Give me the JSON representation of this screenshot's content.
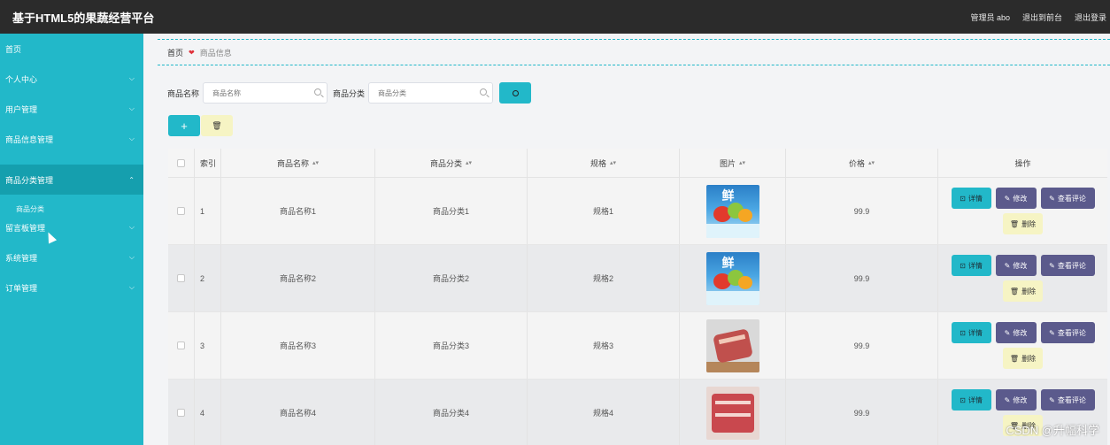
{
  "header": {
    "title": "基于HTML5的果蔬经营平台",
    "user_label": "管理员 abo",
    "back_to_front": "退出到前台",
    "logout": "退出登录"
  },
  "sidebar": {
    "items": [
      {
        "label": "首页",
        "has_chevron": false
      },
      {
        "label": "个人中心",
        "has_chevron": true
      },
      {
        "label": "用户管理",
        "has_chevron": true
      },
      {
        "label": "商品信息管理",
        "has_chevron": true
      },
      {
        "label": "商品分类管理",
        "has_chevron": true,
        "active": true
      },
      {
        "label": "商品分类",
        "submenu": true
      },
      {
        "label": "留言板管理",
        "has_chevron": true
      },
      {
        "label": "系统管理",
        "has_chevron": true
      },
      {
        "label": "订单管理",
        "has_chevron": true
      }
    ]
  },
  "breadcrumb": {
    "home": "首页",
    "separator": "❤",
    "current": "商品信息"
  },
  "search": {
    "name_label": "商品名称",
    "name_placeholder": "商品名称",
    "category_label": "商品分类",
    "category_placeholder": "商品分类"
  },
  "actions": {
    "add_symbol": "+",
    "delete_symbol": "🗑"
  },
  "table": {
    "headers": {
      "index": "索引",
      "name": "商品名称",
      "category": "商品分类",
      "spec": "规格",
      "image": "图片",
      "price": "价格",
      "ops": "操作"
    },
    "sort_symbol": "▴▾",
    "rows": [
      {
        "index": "1",
        "name": "商品名称1",
        "category": "商品分类1",
        "spec": "规格1",
        "price": "99.9",
        "image": "fresh-produce"
      },
      {
        "index": "2",
        "name": "商品名称2",
        "category": "商品分类2",
        "spec": "规格2",
        "price": "99.9",
        "image": "fresh-produce"
      },
      {
        "index": "3",
        "name": "商品名称3",
        "category": "商品分类3",
        "spec": "规格3",
        "price": "99.9",
        "image": "meat"
      },
      {
        "index": "4",
        "name": "商品名称4",
        "category": "商品分类4",
        "spec": "规格4",
        "price": "99.9",
        "image": "pork"
      }
    ],
    "ops": {
      "detail": "详情",
      "edit": "修改",
      "review": "查看评论",
      "delete": "删除"
    }
  },
  "thumb_text": "鲜",
  "watermark": "CSDN @升幅科学",
  "colors": {
    "topbar": "#2b2b2b",
    "sidebar": "#22b8c9",
    "sidebar_active": "#159fae",
    "primary": "#22b8c9",
    "secondary": "#5b5a8c",
    "warning": "#f6f4c4",
    "breadcrumb_sep": "#e0313b"
  }
}
